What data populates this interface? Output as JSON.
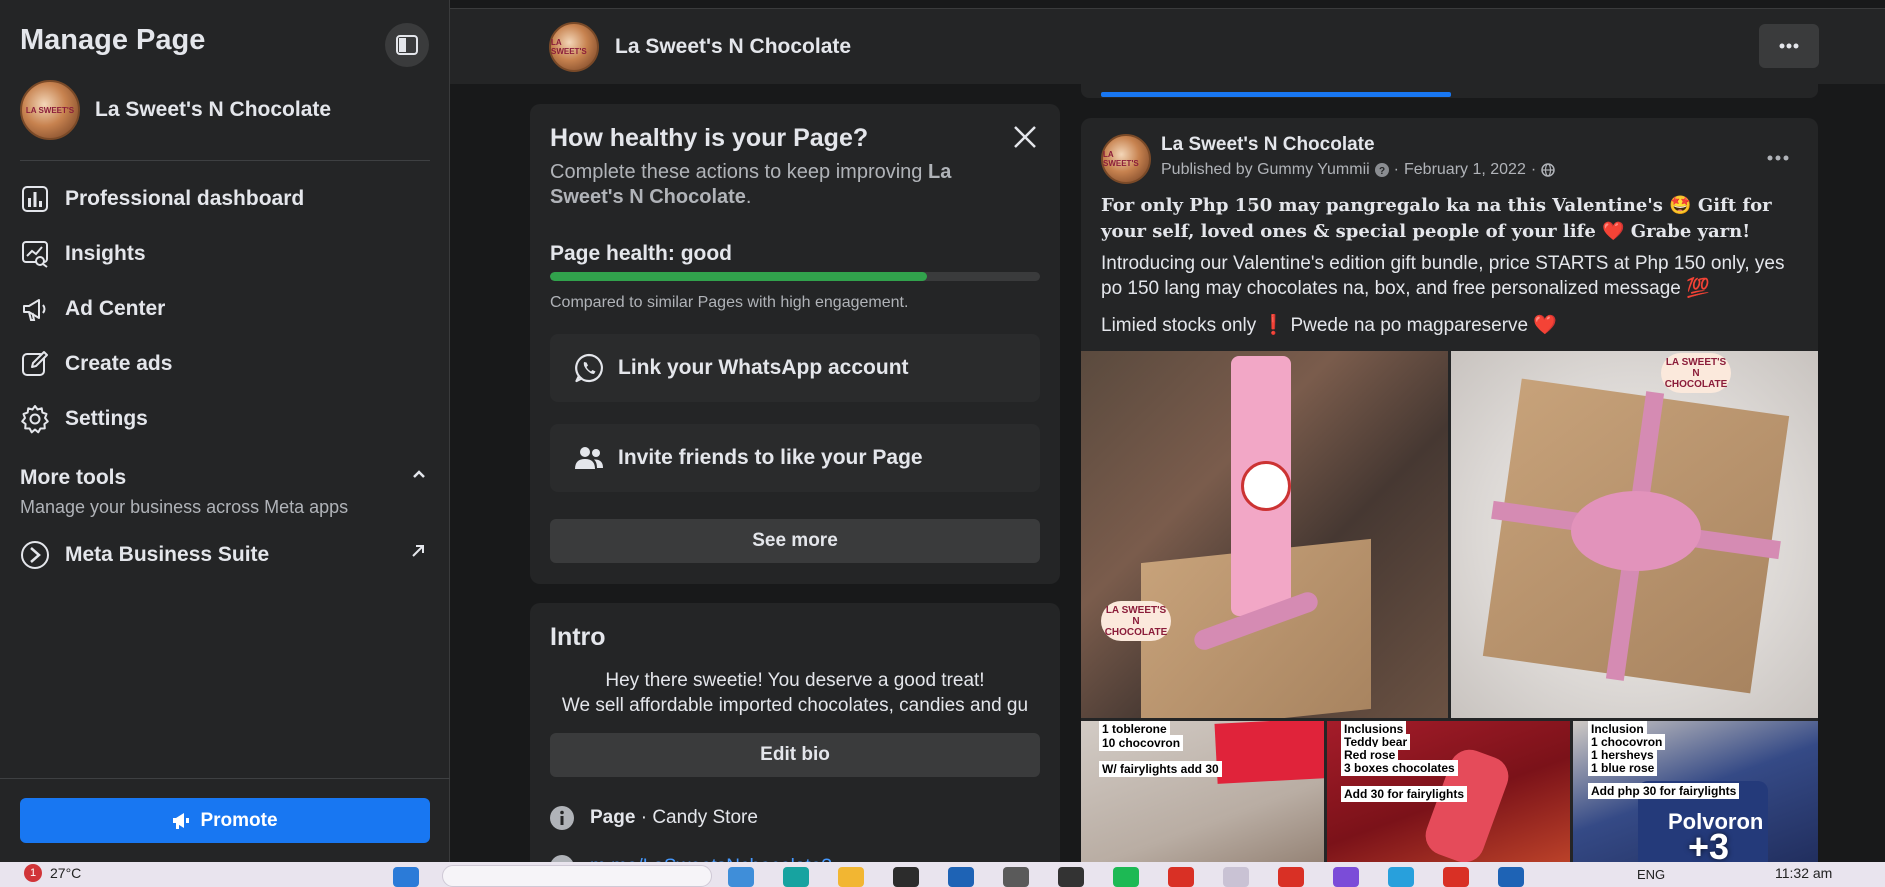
{
  "sidebar": {
    "header": "Manage Page",
    "page_name": "La Sweet's N Chocolate",
    "items": [
      {
        "label": "Professional dashboard",
        "icon": "dashboard-icon"
      },
      {
        "label": "Insights",
        "icon": "insights-icon"
      },
      {
        "label": "Ad Center",
        "icon": "megaphone-icon"
      },
      {
        "label": "Create ads",
        "icon": "pencil-square-icon"
      },
      {
        "label": "Settings",
        "icon": "gear-icon"
      }
    ],
    "more_tools": {
      "title": "More tools",
      "subtitle": "Manage your business across Meta apps",
      "meta_business_suite": "Meta Business Suite"
    },
    "promote_label": "Promote"
  },
  "topbar": {
    "page_name": "La Sweet's N Chocolate"
  },
  "health_card": {
    "title": "How healthy is your Page?",
    "subtitle_prefix": "Complete these actions to keep improving ",
    "subtitle_page": "La Sweet's N Chocolate",
    "subtitle_suffix": ".",
    "health_label": "Page health: good",
    "health_fraction": 0.77,
    "compare_text": "Compared to similar Pages with high engagement.",
    "actions": [
      {
        "label": "Link your WhatsApp account",
        "icon": "whatsapp-icon"
      },
      {
        "label": "Invite friends to like your Page",
        "icon": "people-icon"
      }
    ],
    "see_more_label": "See more"
  },
  "intro_card": {
    "title": "Intro",
    "bio_line1": "Hey there sweetie! You deserve a good treat!",
    "bio_line2": "We sell affordable imported chocolates, candies and gu",
    "edit_bio_label": "Edit bio",
    "category_prefix": "Page",
    "category_sep": " · ",
    "category": "Candy Store",
    "link": "m.me/LaSweetsNchocolate?"
  },
  "post": {
    "author": "La Sweet's N Chocolate",
    "published_by": "Published by Gummy Yummii",
    "date": "February 1, 2022",
    "meta_sep": "·",
    "text_line1": "For only Php 150 may pangregalo ka na this Valentine's 🤩 Gift for your self, loved ones & special people of your life ❤️ Grabe yarn!",
    "text_line2": "Introducing our Valentine's edition gift bundle, price STARTS at Php 150 only, yes po 150 lang may chocolates na, box, and free personalized message 💯",
    "text_line3": "Limied stocks only ❗ Pwede na po magpareserve ❤️",
    "photo_labels": {
      "p3": [
        "1 toblerone",
        "10 chocovron",
        "W/ fairylights add 30"
      ],
      "p4": [
        "Inclusions",
        "Teddy bear",
        "Red rose",
        "3 boxes chocolates",
        "Add 30 for fairylights"
      ],
      "p5": [
        "Inclusion",
        "1 chocovron",
        "1 hersheys",
        "1 blue rose",
        "Add php 30 for fairylights"
      ]
    },
    "sticker_text": "LA SWEET'S N CHOCOLATE",
    "sticker_short": "LA SWEET'S",
    "sticker_short2": "CHOCOLATE",
    "more_count": "+3",
    "product_brand": "Polvoron"
  },
  "taskbar": {
    "notification_count": "1",
    "temperature": "27°C",
    "language": "ENG",
    "time": "11:32 am"
  },
  "colors": {
    "accent": "#1877f2",
    "health_good": "#31a24c",
    "background": "#18191a",
    "card": "#242526"
  }
}
